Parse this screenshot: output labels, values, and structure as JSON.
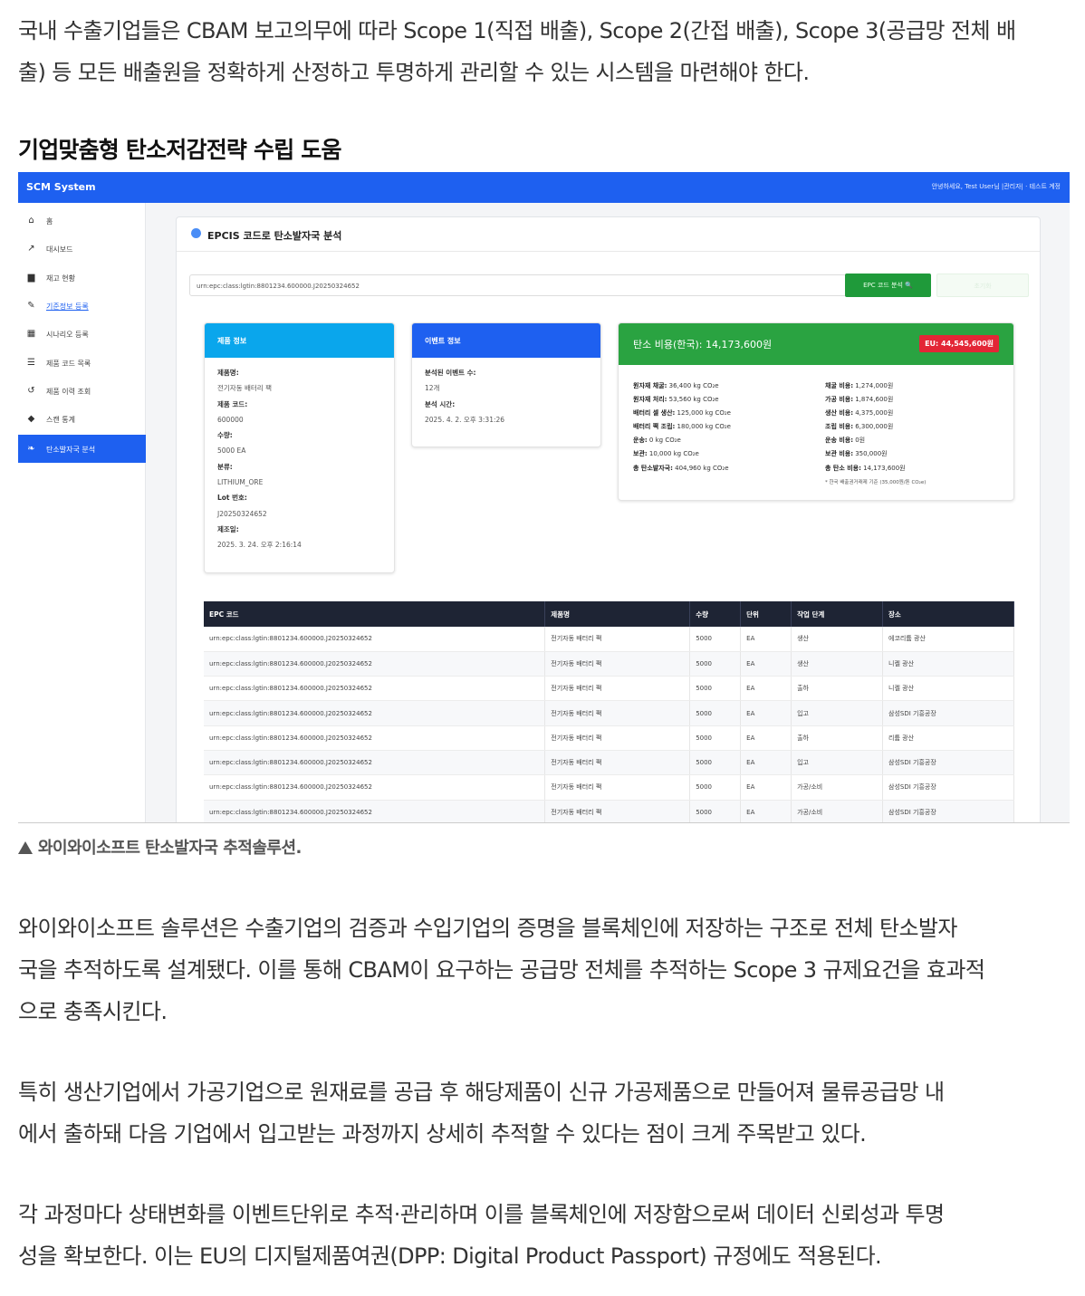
{
  "article": {
    "p1": [
      "국내 수출기업들은 CBAM 보고의무에 따라 Scope 1(직접 배출), Scope 2(간접 배출), Scope 3(공급망 전체 배",
      "출) 등 모든 배출원을 정확하게 산정하고 투명하게 관리할 수 있는 시스템을 마련해야 한다."
    ],
    "subheading": "기업맞춤형 탄소저감전략 수립 도움",
    "caption": "와이와이소프트 탄소발자국 추적솔루션.",
    "p2": [
      "와이와이소프트 솔루션은 수출기업의 검증과 수입기업의 증명을 블록체인에 저장하는 구조로 전체 탄소발자",
      "국을 추적하도록 설계됐다. 이를 통해 CBAM이 요구하는 공급망 전체를 추적하는 Scope 3 규제요건을 효과적",
      "으로 충족시킨다."
    ],
    "p3": [
      "특히 생산기업에서 가공기업으로 원재료를 공급 후 해당제품이 신규 가공제품으로 만들어져 물류공급망 내",
      "에서 출하돼 다음 기업에서 입고받는 과정까지 상세히 추적할 수 있다는 점이 크게 주목받고 있다."
    ],
    "p4": [
      "각 과정마다 상태변화를 이벤트단위로 추적·관리하며 이를 블록체인에 저장함으로써 데이터 신뢰성과 투명",
      "성을 확보한다. 이는 EU의 디지털제품여권(DPP: Digital Product Passport) 규정에도 적용된다."
    ]
  },
  "app": {
    "brand": "SCM System",
    "user_text": "안녕하세요, Test User님  |관리자|  · 테스트 계정",
    "sidebar": [
      {
        "icon": "home-icon",
        "glyph": "⌂",
        "label": "홈"
      },
      {
        "icon": "chart-icon",
        "glyph": "↗",
        "label": "대시보드"
      },
      {
        "icon": "warehouse-icon",
        "glyph": "▆",
        "label": "재고 현황"
      },
      {
        "icon": "edit-icon",
        "glyph": "✎",
        "label": "기준정보 등록"
      },
      {
        "icon": "grid-icon",
        "glyph": "▦",
        "label": "시나리오 등록"
      },
      {
        "icon": "list-icon",
        "glyph": "☰",
        "label": "제품 코드 목록"
      },
      {
        "icon": "history-icon",
        "glyph": "↺",
        "label": "제품 이력 조회"
      },
      {
        "icon": "tag-icon",
        "glyph": "◆",
        "label": "스캔 통계"
      },
      {
        "icon": "leaf-icon",
        "glyph": "❧",
        "label": "탄소발자국 분석"
      }
    ],
    "panel_title": "EPCIS 코드로 탄소발자국 분석",
    "epc_value": "urn:epc:class:lgtin:8801234.600000.J20250324652",
    "analyze_button": "EPC 코드 분석 🔍",
    "ghost_button": "초기화",
    "product": {
      "header": "제품 정보",
      "fields": [
        {
          "label": "제품명:",
          "value": "전기자동 배터리 팩"
        },
        {
          "label": "제품 코드:",
          "value": "600000"
        },
        {
          "label": "수량:",
          "value": "5000 EA"
        },
        {
          "label": "분류:",
          "value": "LITHIUM_ORE"
        },
        {
          "label": "Lot 번호:",
          "value": "J20250324652"
        },
        {
          "label": "제조일:",
          "value": "2025. 3. 24. 오후 2:16:14"
        }
      ]
    },
    "event": {
      "header": "이벤트 정보",
      "fields": [
        {
          "label": "분석된 이벤트 수:",
          "value": "12개"
        },
        {
          "label": "분석 시간:",
          "value": "2025. 4. 2. 오후 3:31:26"
        }
      ]
    },
    "carbon": {
      "header": "탄소 비용(한국): 14,173,600원",
      "eu_badge": "EU: 44,545,600원",
      "left": [
        {
          "label": "원자재 채굴:",
          "value": " 36,400 kg CO₂e"
        },
        {
          "label": "원자재 처리:",
          "value": " 53,560 kg CO₂e"
        },
        {
          "label": "배터리 셀 생산:",
          "value": " 125,000 kg CO₂e"
        },
        {
          "label": "배터리 팩 조립:",
          "value": " 180,000 kg CO₂e"
        },
        {
          "label": "운송:",
          "value": " 0 kg CO₂e"
        },
        {
          "label": "보관:",
          "value": " 10,000 kg CO₂e"
        },
        {
          "label": "총 탄소발자국:",
          "value": " 404,960 kg CO₂e"
        }
      ],
      "right": [
        {
          "label": "채굴 비용:",
          "value": " 1,274,000원"
        },
        {
          "label": "가공 비용:",
          "value": " 1,874,600원"
        },
        {
          "label": "생산 비용:",
          "value": " 4,375,000원"
        },
        {
          "label": "조립 비용:",
          "value": " 6,300,000원"
        },
        {
          "label": "운송 비용:",
          "value": " 0원"
        },
        {
          "label": "보관 비용:",
          "value": " 350,000원"
        },
        {
          "label": "총 탄소 비용:",
          "value": " 14,173,600원"
        }
      ],
      "note": "* 한국 배출권거래제 기준 (35,000원/톤 CO₂e)"
    },
    "table": {
      "headers": [
        "EPC 코드",
        "제품명",
        "수량",
        "단위",
        "작업 단계",
        "장소"
      ],
      "rows": [
        [
          "urn:epc:class:lgtin:8801234.600000.J20250324652",
          "전기자동 배터리 팩",
          "5000",
          "EA",
          "생산",
          "에코리튬 광산"
        ],
        [
          "urn:epc:class:lgtin:8801234.600000.J20250324652",
          "전기자동 배터리 팩",
          "5000",
          "EA",
          "생산",
          "니켈 광산"
        ],
        [
          "urn:epc:class:lgtin:8801234.600000.J20250324652",
          "전기자동 배터리 팩",
          "5000",
          "EA",
          "출하",
          "니켈 광산"
        ],
        [
          "urn:epc:class:lgtin:8801234.600000.J20250324652",
          "전기자동 배터리 팩",
          "5000",
          "EA",
          "입고",
          "삼성SDI 기흥공장"
        ],
        [
          "urn:epc:class:lgtin:8801234.600000.J20250324652",
          "전기자동 배터리 팩",
          "5000",
          "EA",
          "출하",
          "리튬 광산"
        ],
        [
          "urn:epc:class:lgtin:8801234.600000.J20250324652",
          "전기자동 배터리 팩",
          "5000",
          "EA",
          "입고",
          "삼성SDI 기흥공장"
        ],
        [
          "urn:epc:class:lgtin:8801234.600000.J20250324652",
          "전기자동 배터리 팩",
          "5000",
          "EA",
          "가공/소비",
          "삼성SDI 기흥공장"
        ],
        [
          "urn:epc:class:lgtin:8801234.600000.J20250324652",
          "전기자동 배터리 팩",
          "5000",
          "EA",
          "가공/소비",
          "삼성SDI 기흥공장"
        ]
      ]
    }
  }
}
